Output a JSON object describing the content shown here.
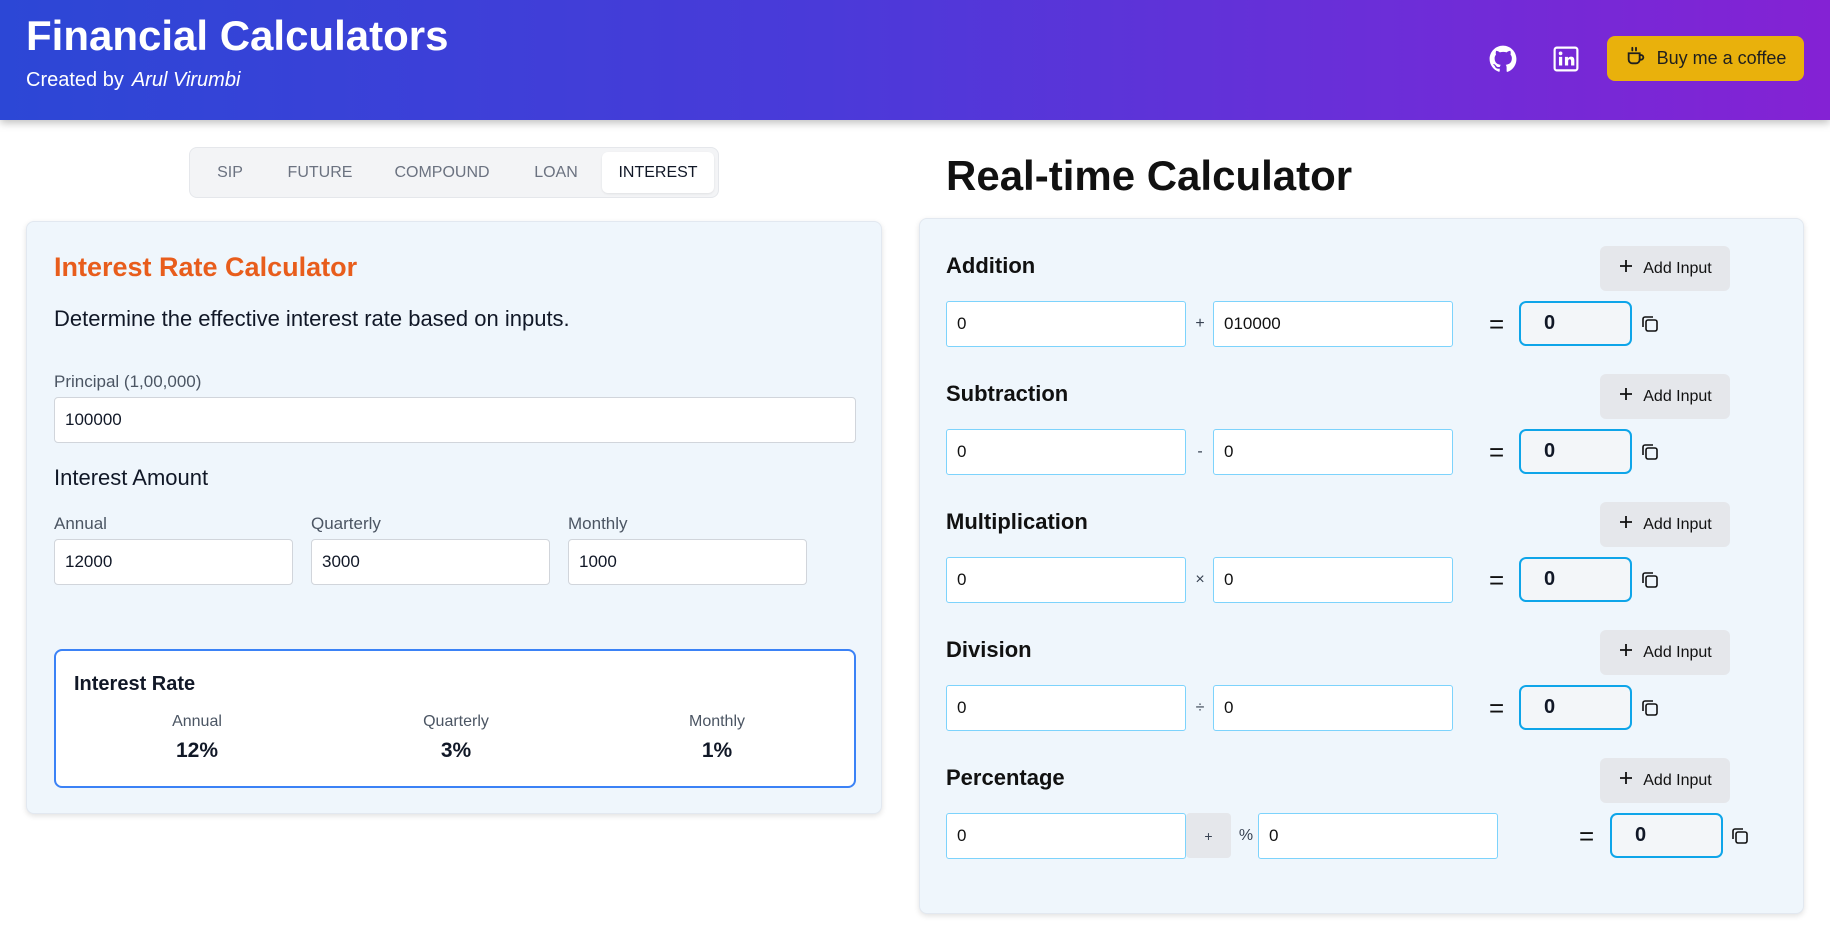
{
  "header": {
    "title": "Financial Calculators",
    "created_by": "Created by",
    "author": "Arul Virumbi",
    "github_icon": "github-icon",
    "linkedin_icon": "linkedin-icon",
    "coffee_label": "Buy me a coffee",
    "coffee_icon": "coffee-cup-icon",
    "coffee_color": "#e9b10c"
  },
  "tabs": [
    "SIP",
    "FUTURE",
    "COMPOUND",
    "LOAN",
    "INTEREST"
  ],
  "active_tab": "INTEREST",
  "interest": {
    "title": "Interest Rate Calculator",
    "description": "Determine the effective interest rate based on inputs.",
    "principal_label": "Principal (1,00,000)",
    "principal_value": "100000",
    "amount_heading": "Interest Amount",
    "annual_label": "Annual",
    "annual_value": "12000",
    "quarterly_label": "Quarterly",
    "quarterly_value": "3000",
    "monthly_label": "Monthly",
    "monthly_value": "1000",
    "rate_title": "Interest Rate",
    "rate_annual_label": "Annual",
    "rate_annual": "12%",
    "rate_quarterly_label": "Quarterly",
    "rate_quarterly": "3%",
    "rate_monthly_label": "Monthly",
    "rate_monthly": "1%"
  },
  "realtime": {
    "title": "Real-time Calculator",
    "add_input_label": "Add Input",
    "equals": "=",
    "operations": [
      {
        "label": "Addition",
        "a": "0",
        "op": "+",
        "b": "010000",
        "result": "0"
      },
      {
        "label": "Subtraction",
        "a": "0",
        "op": "-",
        "b": "0",
        "result": "0"
      },
      {
        "label": "Multiplication",
        "a": "0",
        "op": "×",
        "b": "0",
        "result": "0"
      },
      {
        "label": "Division",
        "a": "0",
        "op": "÷",
        "b": "0",
        "result": "0"
      },
      {
        "label": "Percentage",
        "a": "0",
        "toggle": "+",
        "op": "%",
        "b": "0",
        "result": "0"
      }
    ]
  },
  "colors": {
    "header_gradient_start": "#2c47d6",
    "header_gradient_end": "#8422d4",
    "calculator_title": "#e85d1c",
    "result_border": "#0ea5e9",
    "rate_box_border": "#3b82f6"
  }
}
